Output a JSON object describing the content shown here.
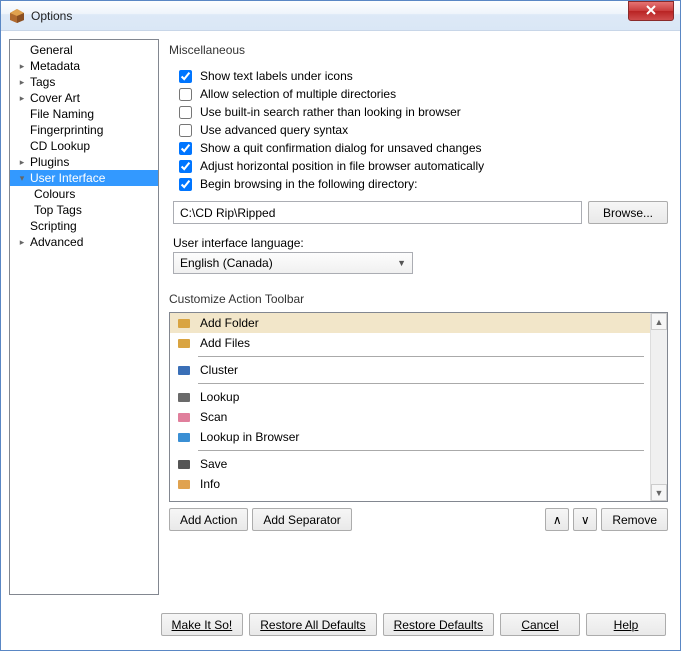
{
  "window": {
    "title": "Options"
  },
  "nav": {
    "items": [
      {
        "label": "General",
        "expander": "",
        "cls": "childless"
      },
      {
        "label": "Metadata",
        "expander": "▸",
        "cls": ""
      },
      {
        "label": "Tags",
        "expander": "▸",
        "cls": ""
      },
      {
        "label": "Cover Art",
        "expander": "▸",
        "cls": ""
      },
      {
        "label": "File Naming",
        "expander": "",
        "cls": "childless"
      },
      {
        "label": "Fingerprinting",
        "expander": "",
        "cls": "childless"
      },
      {
        "label": "CD Lookup",
        "expander": "",
        "cls": "childless"
      },
      {
        "label": "Plugins",
        "expander": "▸",
        "cls": ""
      },
      {
        "label": "User Interface",
        "expander": "▾",
        "cls": "selected"
      },
      {
        "label": "Colours",
        "expander": "",
        "cls": "child"
      },
      {
        "label": "Top Tags",
        "expander": "",
        "cls": "child"
      },
      {
        "label": "Scripting",
        "expander": "",
        "cls": "childless"
      },
      {
        "label": "Advanced",
        "expander": "▸",
        "cls": ""
      }
    ]
  },
  "misc": {
    "title": "Miscellaneous",
    "checks": [
      {
        "label": "Show text labels under icons",
        "checked": true
      },
      {
        "label": "Allow selection of multiple directories",
        "checked": false
      },
      {
        "label": "Use built-in search rather than looking in browser",
        "checked": false
      },
      {
        "label": "Use advanced query syntax",
        "checked": false
      },
      {
        "label": "Show a quit confirmation dialog for unsaved changes",
        "checked": true
      },
      {
        "label": "Adjust horizontal position in file browser automatically",
        "checked": true
      },
      {
        "label": "Begin browsing in the following directory:",
        "checked": true
      }
    ],
    "path": "C:\\CD Rip\\Ripped",
    "browse": "Browse...",
    "lang_label": "User interface language:",
    "lang_value": "English (Canada)"
  },
  "toolbar": {
    "title": "Customize Action Toolbar",
    "items": [
      {
        "label": "Add Folder",
        "icon_color": "#d9a441",
        "selected": true
      },
      {
        "label": "Add Files",
        "icon_color": "#d9a441"
      },
      {
        "sep": true
      },
      {
        "label": "Cluster",
        "icon_color": "#3a6fb7"
      },
      {
        "sep": true
      },
      {
        "label": "Lookup",
        "icon_color": "#6a6a6a"
      },
      {
        "label": "Scan",
        "icon_color": "#e07f9c"
      },
      {
        "label": "Lookup in Browser",
        "icon_color": "#3a8fd4"
      },
      {
        "sep": true
      },
      {
        "label": "Save",
        "icon_color": "#555"
      },
      {
        "label": "Info",
        "icon_color": "#e0a24f"
      }
    ],
    "add_action": "Add Action",
    "add_sep": "Add Separator",
    "remove": "Remove"
  },
  "footer": {
    "make": "Make It So!",
    "restore_all": "Restore All Defaults",
    "restore": "Restore Defaults",
    "cancel": "Cancel",
    "help": "Help"
  }
}
